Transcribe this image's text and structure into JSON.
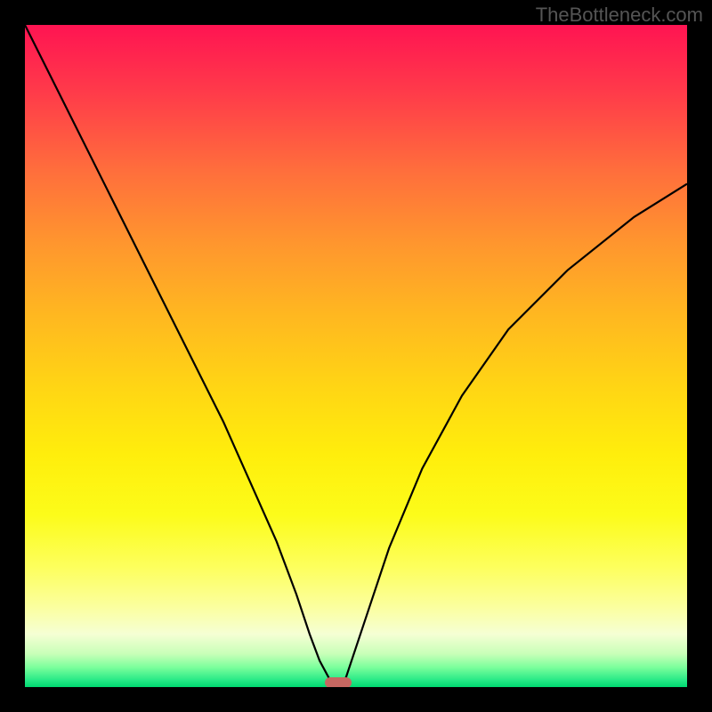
{
  "watermark": "TheBottleneck.com",
  "chart_data": {
    "type": "line",
    "title": "",
    "xlabel": "",
    "ylabel": "",
    "xlim": [
      0,
      100
    ],
    "ylim": [
      0,
      100
    ],
    "background_gradient": {
      "stops": [
        {
          "pos": 0,
          "color": "#ff1452",
          "meaning": "high-bottleneck"
        },
        {
          "pos": 50,
          "color": "#ffd614",
          "meaning": "moderate"
        },
        {
          "pos": 100,
          "color": "#00d870",
          "meaning": "optimal"
        }
      ]
    },
    "series": [
      {
        "name": "bottleneck-curve",
        "x": [
          0,
          6,
          12,
          18,
          24,
          30,
          34,
          38,
          41,
          43,
          44.5,
          46,
          47,
          47.5,
          48.5,
          51,
          55,
          60,
          66,
          73,
          82,
          92,
          100
        ],
        "y": [
          100,
          88,
          76,
          64,
          52,
          40,
          31,
          22,
          14,
          8,
          4,
          1.2,
          0.2,
          0,
          1.5,
          9,
          21,
          33,
          44,
          54,
          63,
          71,
          76
        ]
      }
    ],
    "marker": {
      "x": 47.3,
      "y": 0.7,
      "color": "#c66761"
    }
  },
  "colors": {
    "frame": "#000000",
    "curve": "#000000",
    "watermark": "#555555"
  }
}
